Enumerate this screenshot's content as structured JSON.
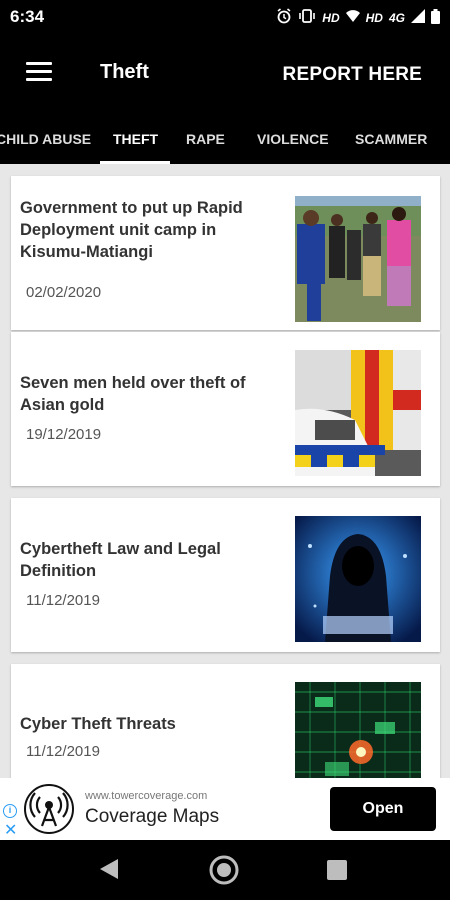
{
  "status_bar": {
    "time": "6:34",
    "indicators": [
      "alarm-icon",
      "vibrate-icon",
      "HD",
      "HD",
      "4G",
      "signal-icon",
      "battery-icon"
    ],
    "hd1": "HD",
    "hd2": "HD",
    "net": "4G"
  },
  "app_bar": {
    "title": "Theft",
    "report_label": "REPORT HERE"
  },
  "tabs": [
    {
      "label": "CHILD ABUSE",
      "active": false
    },
    {
      "label": "THEFT",
      "active": true
    },
    {
      "label": "RAPE",
      "active": false
    },
    {
      "label": "VIOLENCE",
      "active": false
    },
    {
      "label": "SCAMMER",
      "active": false
    }
  ],
  "articles": [
    {
      "title": "Government to put up Rapid Deployment unit camp in Kisumu-Matiangi",
      "date": "02/02/2020",
      "thumbnail": "police-officers-photo"
    },
    {
      "title": "Seven men held over theft of Asian gold",
      "date": "19/12/2019",
      "thumbnail": "police-car-photo"
    },
    {
      "title": "Cybertheft Law and Legal Definition",
      "date": "11/12/2019",
      "thumbnail": "hooded-hacker-photo"
    },
    {
      "title": "Cyber Theft Threats",
      "date": "11/12/2019",
      "thumbnail": "circuit-board-photo"
    }
  ],
  "ad": {
    "url": "www.towercoverage.com",
    "name": "Coverage Maps",
    "cta": "Open"
  },
  "colors": {
    "bar_background": "#000000",
    "content_background": "#e7e7e7",
    "ad_info_accent": "#2a9df4"
  }
}
